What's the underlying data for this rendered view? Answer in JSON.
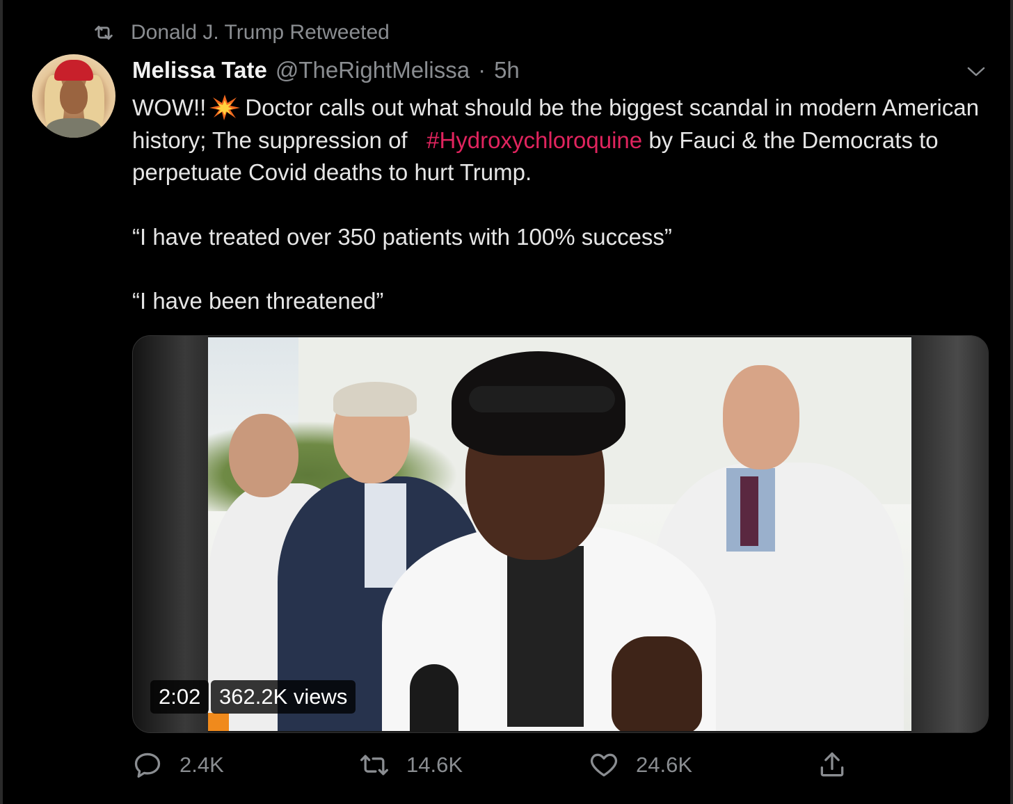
{
  "retweet_context": {
    "icon": "retweet-icon",
    "label": "Donald J. Trump Retweeted"
  },
  "tweet": {
    "author": {
      "display_name": "Melissa Tate",
      "handle": "@TheRightMelissa",
      "separator": "·",
      "time": "5h"
    },
    "text": {
      "line1_a": "WOW!!",
      "emoji": "collision-emoji",
      "line1_b": "Doctor calls out what should be the biggest scandal in modern American history; The suppression of",
      "hashtag": "#Hydroxychloroquine",
      "line1_c": "by Fauci & the Democrats to perpetuate Covid deaths to hurt Trump.",
      "quote1": "“I have treated over 350 patients with 100% success”",
      "quote2": "“I have been threatened”"
    },
    "media": {
      "duration": "2:02",
      "views": "362.2K views"
    },
    "actions": {
      "reply_count": "2.4K",
      "retweet_count": "14.6K",
      "like_count": "24.6K"
    },
    "colors": {
      "hashtag": "#e0245e",
      "muted": "#8a8d91",
      "background": "#000000"
    }
  }
}
